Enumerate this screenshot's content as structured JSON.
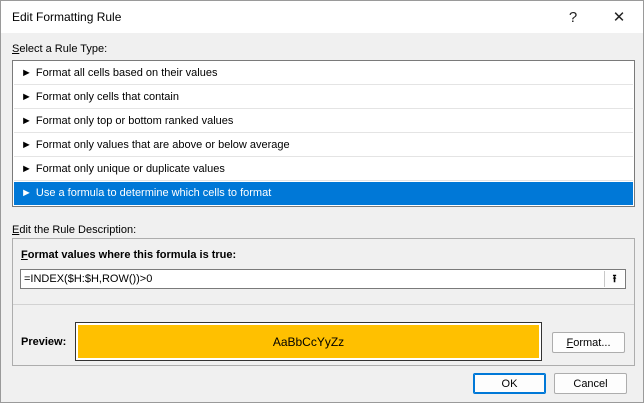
{
  "window": {
    "title": "Edit Formatting Rule",
    "help_glyph": "?",
    "close_glyph": "✕"
  },
  "rule_type": {
    "label_first": "S",
    "label_rest": "elect a Rule Type:",
    "arrow_glyph": "►",
    "items": [
      {
        "label": "Format all cells based on their values",
        "selected": false
      },
      {
        "label": "Format only cells that contain",
        "selected": false
      },
      {
        "label": "Format only top or bottom ranked values",
        "selected": false
      },
      {
        "label": "Format only values that are above or below average",
        "selected": false
      },
      {
        "label": "Format only unique or duplicate values",
        "selected": false
      },
      {
        "label": "Use a formula to determine which cells to format",
        "selected": true
      }
    ]
  },
  "description": {
    "label_first": "E",
    "label_rest": "dit the Rule Description:",
    "formula_label_first": "F",
    "formula_label_rest": "ormat values where this formula is true:",
    "formula_value": "=INDEX($H:$H,ROW())>0",
    "collapse_glyph": "⭱",
    "preview_label": "Preview:",
    "preview_text": "AaBbCcYyZz",
    "preview_fill": "#ffc000",
    "format_label_first": "F",
    "format_label_rest": "ormat..."
  },
  "buttons": {
    "ok": "OK",
    "cancel": "Cancel"
  },
  "colors": {
    "selection": "#0078d7",
    "preview_fill": "#ffc000"
  }
}
